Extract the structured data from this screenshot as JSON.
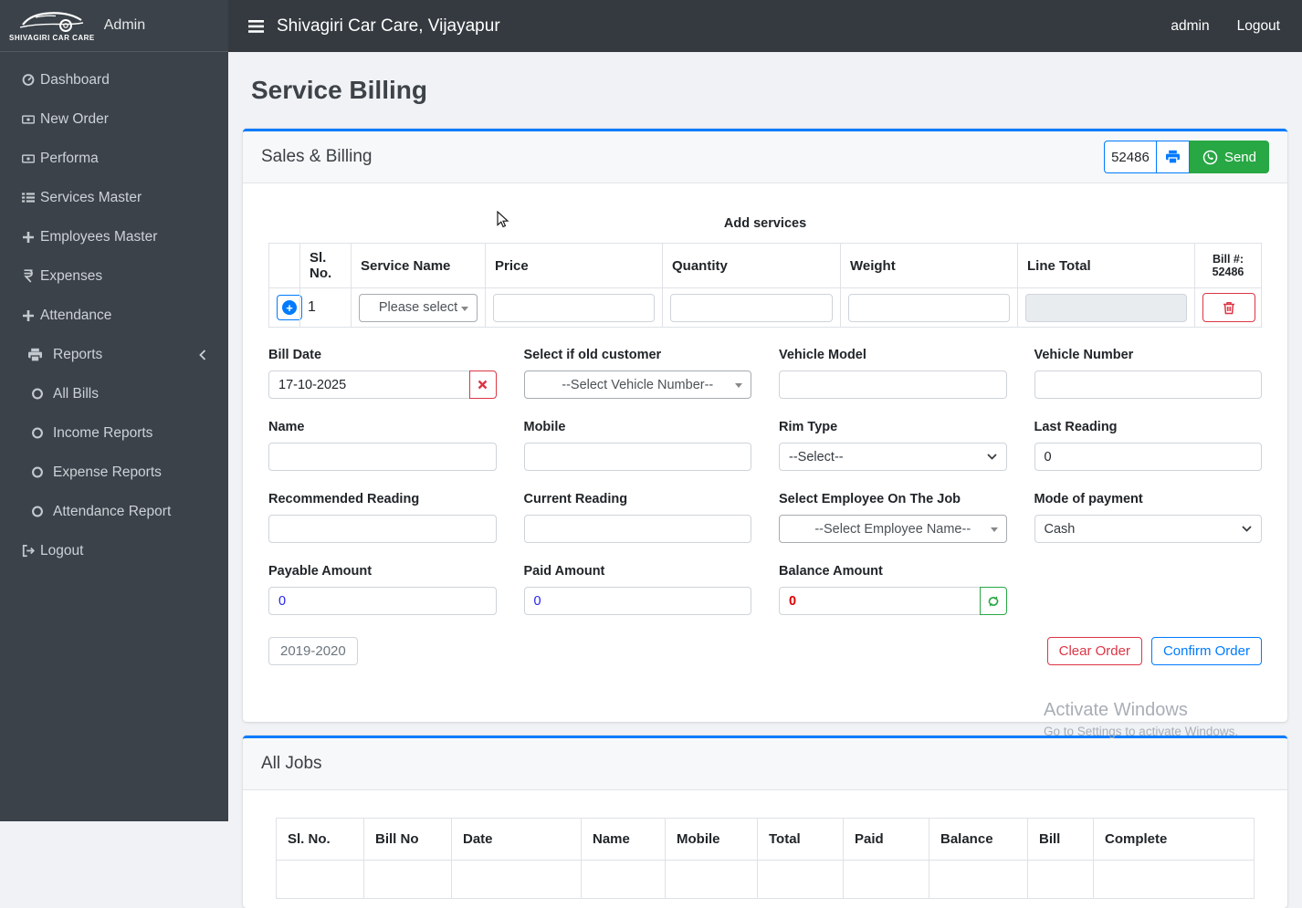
{
  "navbar": {
    "brand_title": "Shivagiri Car Care, Vijayapur",
    "user": "admin",
    "logout": "Logout"
  },
  "sidebar": {
    "logo_caption": "SHIVAGIRI CAR CARE",
    "admin_label": "Admin",
    "items": [
      {
        "label": "Dashboard",
        "icon": "tachometer-icon"
      },
      {
        "label": "New Order",
        "icon": "money-bill-icon"
      },
      {
        "label": "Performa",
        "icon": "money-bill-icon"
      },
      {
        "label": "Services Master",
        "icon": "list-icon"
      },
      {
        "label": "Employees Master",
        "icon": "plus-icon"
      },
      {
        "label": "Expenses",
        "icon": "rupee-icon"
      },
      {
        "label": "Attendance",
        "icon": "plus-icon"
      },
      {
        "label": "Reports",
        "icon": "print-icon"
      },
      {
        "label": "All Bills",
        "icon": "circle-icon"
      },
      {
        "label": "Income Reports",
        "icon": "circle-icon"
      },
      {
        "label": "Expense Reports",
        "icon": "circle-icon"
      },
      {
        "label": "Attendance Report",
        "icon": "circle-icon"
      },
      {
        "label": "Logout",
        "icon": "sign-out-icon"
      }
    ]
  },
  "page": {
    "title": "Service Billing"
  },
  "billing_card": {
    "title": "Sales & Billing",
    "bill_number": "52486",
    "send_label": "Send",
    "add_services_label": "Add services",
    "services_table": {
      "headers": [
        "",
        "Sl. No.",
        "Service Name",
        "Price",
        "Quantity",
        "Weight",
        "Line Total",
        "Bill #: 52486"
      ],
      "row": {
        "sl_no": "1",
        "service_placeholder": "Please select"
      }
    },
    "fields": {
      "bill_date": {
        "label": "Bill Date",
        "value": "17-10-2025"
      },
      "old_customer": {
        "label": "Select if old customer",
        "value": "--Select Vehicle Number--"
      },
      "vehicle_model": {
        "label": "Vehicle Model",
        "value": ""
      },
      "vehicle_number": {
        "label": "Vehicle Number",
        "value": ""
      },
      "name": {
        "label": "Name",
        "value": ""
      },
      "mobile": {
        "label": "Mobile",
        "value": ""
      },
      "rim_type": {
        "label": "Rim Type",
        "value": "--Select--"
      },
      "last_reading": {
        "label": "Last Reading",
        "value": "0"
      },
      "recommended_reading": {
        "label": "Recommended Reading",
        "value": ""
      },
      "current_reading": {
        "label": "Current Reading",
        "value": ""
      },
      "employee": {
        "label": "Select Employee On The Job",
        "value": "--Select Employee Name--"
      },
      "payment_mode": {
        "label": "Mode of payment",
        "value": "Cash"
      },
      "payable_amount": {
        "label": "Payable Amount",
        "value": "0"
      },
      "paid_amount": {
        "label": "Paid Amount",
        "value": "0"
      },
      "balance_amount": {
        "label": "Balance Amount",
        "value": "0"
      }
    },
    "year_button": "2019-2020",
    "clear_button": "Clear Order",
    "confirm_button": "Confirm Order"
  },
  "jobs_card": {
    "title": "All Jobs",
    "headers": [
      "Sl. No.",
      "Bill No",
      "Date",
      "Name",
      "Mobile",
      "Total",
      "Paid",
      "Balance",
      "Bill",
      "Complete"
    ]
  },
  "watermark": {
    "line1": "Activate Windows",
    "line2": "Go to Settings to activate Windows."
  },
  "colors": {
    "accent": "#007bff",
    "success": "#28a745",
    "danger": "#dc3545",
    "dark": "#343a40",
    "sidebar_bg": "#3b4249",
    "page_bg": "#f0f2f5"
  }
}
